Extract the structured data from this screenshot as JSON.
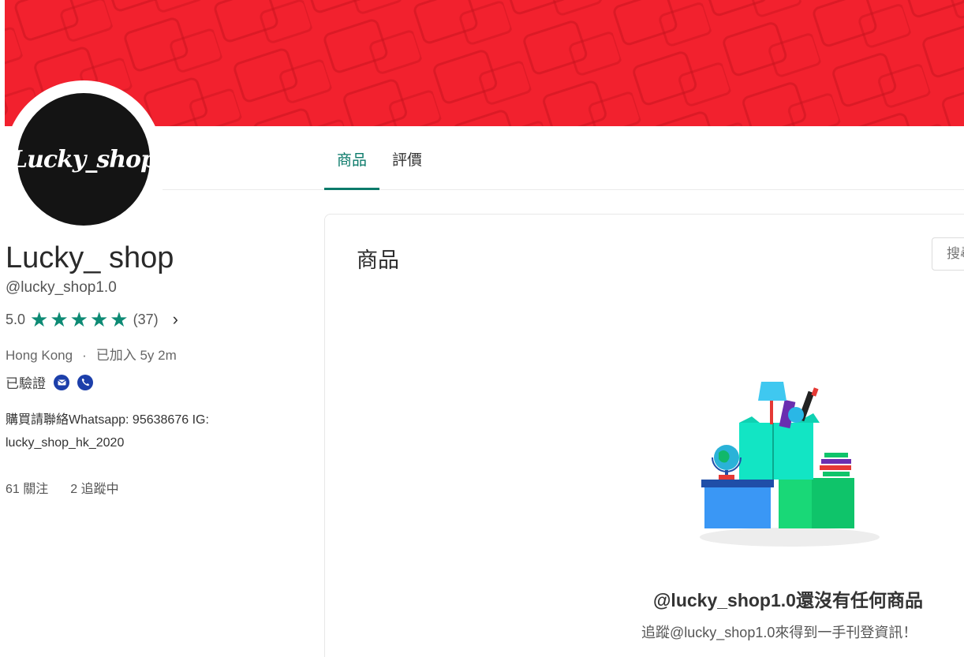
{
  "shop": {
    "logo_text": "Lucky_shop",
    "name": "Lucky_ shop",
    "handle": "@lucky_shop1.0",
    "rating_score": "5.0",
    "rating_stars": 5,
    "review_count": "(37)",
    "location": "Hong Kong",
    "separator": "·",
    "joined": "已加入 5y 2m",
    "verified_label": "已驗證",
    "verified_icons": [
      "mail-icon",
      "phone-icon"
    ],
    "bio": "購買請聯絡Whatsapp: 95638676 IG: lucky_shop_hk_2020",
    "followers": "61 關注",
    "following": "2 追蹤中"
  },
  "tabs": [
    {
      "label": "商品",
      "active": true
    },
    {
      "label": "評價",
      "active": false
    }
  ],
  "products": {
    "title": "商品",
    "search_placeholder": "搜尋",
    "empty_title": "@lucky_shop1.0還沒有任何商品",
    "empty_subtitle": "追蹤@lucky_shop1.0來得到一手刊登資訊！"
  },
  "colors": {
    "cover": "#f2212e",
    "accent": "#0b7a6a",
    "star": "#0d8a74",
    "verified": "#1c3faa"
  }
}
